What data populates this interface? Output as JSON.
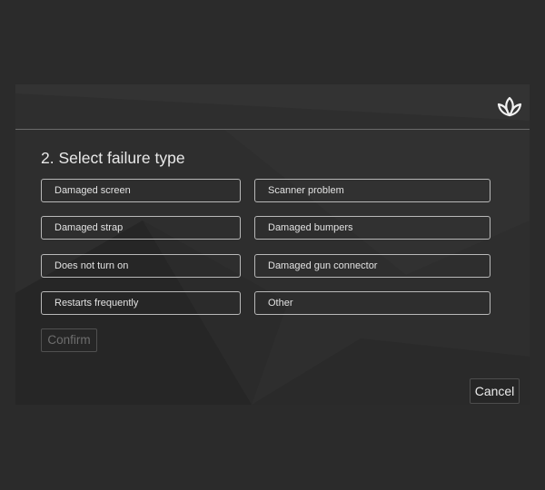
{
  "dialog": {
    "title": "2. Select failure type"
  },
  "options": [
    "Damaged screen",
    "Scanner problem",
    "Damaged strap",
    "Damaged bumpers",
    "Does not turn on",
    "Damaged gun connector",
    "Restarts frequently",
    "Other"
  ],
  "buttons": {
    "confirm": "Confirm",
    "cancel": "Cancel"
  },
  "logo": {
    "icon": "lotus-icon"
  },
  "colors": {
    "page_background": "#2b2b2b",
    "panel_background": "#2e2e2e",
    "option_border": "#b8b8b8",
    "text": "#e2e2e2",
    "disabled_text": "#6e6e6e"
  }
}
